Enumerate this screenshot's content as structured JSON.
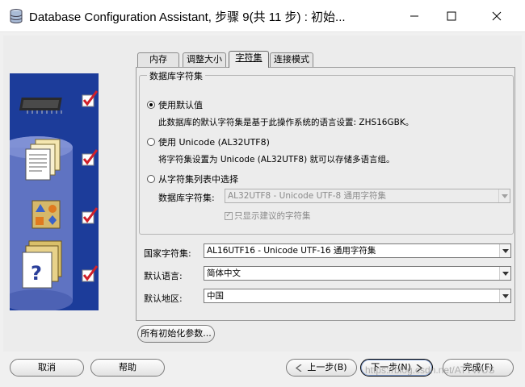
{
  "window": {
    "title": "Database Configuration Assistant, 步骤 9(共 11 步) : 初始..."
  },
  "tabs": [
    {
      "label": "内存"
    },
    {
      "label": "调整大小"
    },
    {
      "label": "字符集",
      "active": true
    },
    {
      "label": "连接模式"
    }
  ],
  "charset_group": {
    "title": "数据库字符集",
    "options": [
      {
        "label": "使用默认值",
        "selected": true,
        "description": "此数据库的默认字符集是基于此操作系统的语言设置: ZHS16GBK。"
      },
      {
        "label": "使用 Unicode (AL32UTF8)",
        "selected": false,
        "description": "将字符集设置为 Unicode (AL32UTF8) 就可以存储多语言组。"
      },
      {
        "label": "从字符集列表中选择",
        "selected": false
      }
    ],
    "db_charset_label": "数据库字符集:",
    "db_charset_value": "AL32UTF8 - Unicode UTF-8 通用字符集",
    "show_recommended_label": "只显示建议的字符集",
    "show_recommended_checked": true
  },
  "national_charset": {
    "label": "国家字符集:",
    "value": "AL16UTF16 - Unicode UTF-16 通用字符集"
  },
  "default_language": {
    "label": "默认语言:",
    "value": "简体中文"
  },
  "default_territory": {
    "label": "默认地区:",
    "value": "中国"
  },
  "all_params_button": "所有初始化参数...",
  "footer": {
    "cancel": "取消",
    "help": "帮助",
    "back": "上一步(B)",
    "next": "下一步(N)",
    "finish": "完成(F)"
  },
  "watermark": "https://blog.csdn.net/ATTWUS",
  "colors": {
    "illustration_bg": "#1c3c9a",
    "check_red": "#d0202a"
  },
  "icons": [
    "app-database-icon",
    "minimize-icon",
    "maximize-icon",
    "close-icon",
    "memory-chip-icon",
    "documents-icon",
    "shapes-icon",
    "folders-help-icon",
    "checkmark-icon",
    "dropdown-arrow-icon",
    "back-arrow-icon",
    "next-arrow-icon"
  ]
}
